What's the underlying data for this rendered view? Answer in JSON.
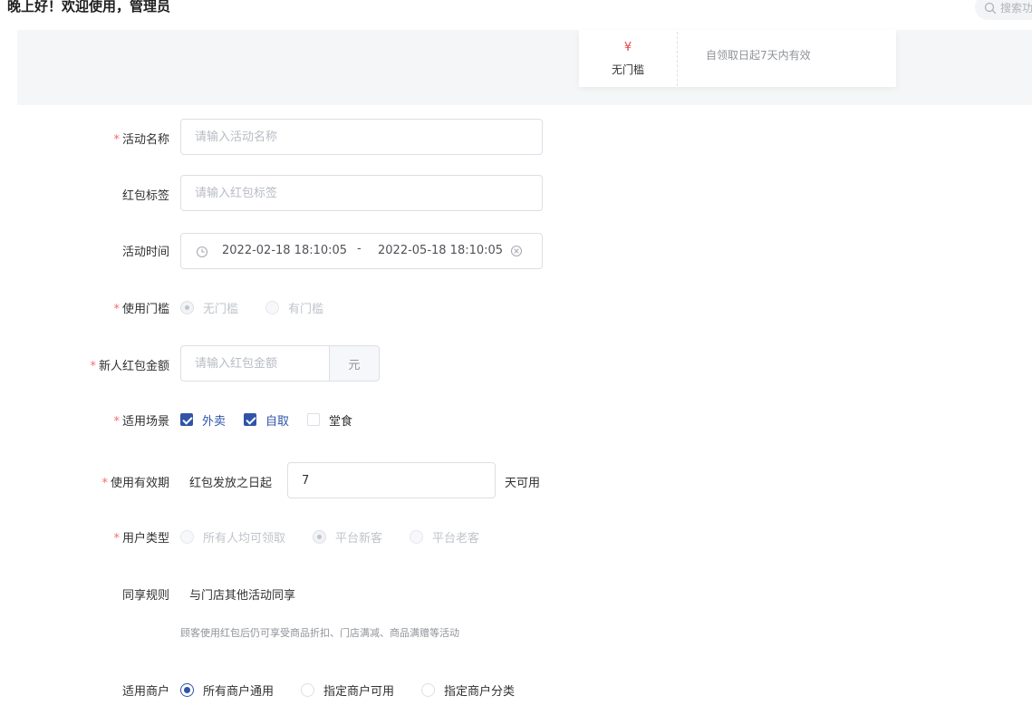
{
  "header": {
    "greeting": "晚上好！欢迎使用，管理员",
    "search_placeholder": "搜索功",
    "search_icon": "search-icon"
  },
  "preview": {
    "currency_symbol": "¥",
    "threshold_text": "无门槛",
    "validity_text": "自领取日起7天内有效"
  },
  "form": {
    "activity_name": {
      "label": "活动名称",
      "required_mark": "*",
      "placeholder": "请输入活动名称",
      "value": ""
    },
    "packet_tag": {
      "label": "红包标签",
      "placeholder": "请输入红包标签",
      "value": ""
    },
    "activity_time": {
      "label": "活动时间",
      "start": "2022-02-18 18:10:05",
      "separator": "-",
      "end": "2022-05-18 18:10:05",
      "icon": "clock-icon",
      "clear_icon": "circle-close-icon"
    },
    "threshold": {
      "label": "使用门槛",
      "required_mark": "*",
      "options": [
        "无门槛",
        "有门槛"
      ],
      "selected": "无门槛",
      "disabled": true
    },
    "new_user_amount": {
      "label": "新人红包金额",
      "required_mark": "*",
      "placeholder": "请输入红包金额",
      "unit": "元"
    },
    "scenes": {
      "label": "适用场景",
      "required_mark": "*",
      "options": [
        {
          "label": "外卖",
          "checked": true
        },
        {
          "label": "自取",
          "checked": true
        },
        {
          "label": "堂食",
          "checked": false
        }
      ]
    },
    "validity": {
      "label": "使用有效期",
      "required_mark": "*",
      "prefix": "红包发放之日起",
      "days": "7",
      "suffix": "天可用"
    },
    "user_type": {
      "label": "用户类型",
      "required_mark": "*",
      "options": [
        "所有人均可领取",
        "平台新客",
        "平台老客"
      ],
      "selected": "平台新客",
      "disabled": true
    },
    "share_rule": {
      "label": "同享规则",
      "value": "与门店其他活动同享",
      "hint": "顾客使用红包后仍可享受商品折扣、门店满减、商品满赠等活动"
    },
    "merchant": {
      "label": "适用商户",
      "options": [
        "所有商户通用",
        "指定商户可用",
        "指定商户分类"
      ],
      "selected": "所有商户通用"
    }
  },
  "colors": {
    "primary": "#2f54a8",
    "required": "#f56c6c",
    "coupon_symbol": "#e64545",
    "border": "#dcdfe6",
    "preview_bg": "#f5f6f7"
  }
}
